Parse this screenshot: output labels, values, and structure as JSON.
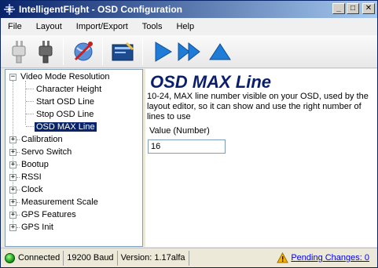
{
  "window": {
    "title": "IntelligentFlight - OSD Configuration",
    "minimize_label": "_",
    "maximize_label": "□",
    "close_label": "✕"
  },
  "menu": {
    "items": [
      "File",
      "Layout",
      "Import/Export",
      "Tools",
      "Help"
    ]
  },
  "toolbar": {
    "buttons": [
      {
        "icon": "plug-disconnected-icon"
      },
      {
        "icon": "plug-connected-icon"
      },
      {
        "icon": "antenna-wave-icon"
      },
      {
        "icon": "edit-panel-icon"
      },
      {
        "icon": "play-icon"
      },
      {
        "icon": "fast-forward-icon"
      },
      {
        "icon": "upload-triangle-icon"
      }
    ]
  },
  "tree": {
    "expanded": {
      "label": "Video Mode Resolution",
      "expander": "−",
      "children": [
        "Character Height",
        "Start OSD Line",
        "Stop OSD Line",
        "OSD MAX Line"
      ]
    },
    "selected": "OSD MAX Line",
    "collapsed_expander": "+",
    "collapsed": [
      "Calibration",
      "Servo Switch",
      "Bootup",
      "RSSI",
      "Clock",
      "Measurement Scale",
      "GPS Features",
      "GPS Init"
    ]
  },
  "content": {
    "title": "OSD MAX Line",
    "description": "10-24, MAX line number visible on your OSD, used by the layout editor, so it can show and use the right number of lines to use",
    "value_label": "Value (Number)",
    "value": "16"
  },
  "status": {
    "connection": "Connected",
    "baud": "19200 Baud",
    "version": "Version: 1.17alfa",
    "pending": "Pending Changes: 0"
  },
  "colors": {
    "title_bar_start": "#0a246a",
    "title_bar_end": "#a6caf0",
    "selection": "#0a246a",
    "heading": "#0a1e6e",
    "link": "#0000ee",
    "toolbar_arrow": "#1e7bd6",
    "status_led": "#1e9d1e"
  }
}
